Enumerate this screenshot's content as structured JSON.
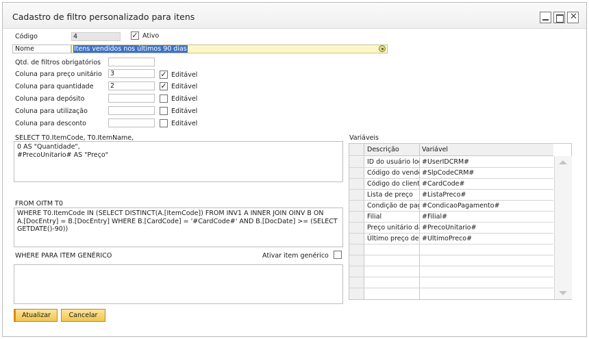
{
  "window": {
    "title": "Cadastro de filtro personalizado para itens"
  },
  "form": {
    "codigo_label": "Código",
    "codigo_value": "4",
    "ativo_label": "Ativo",
    "ativo_checked": true,
    "nome_label": "Nome",
    "nome_value": "Itens vendidos nos últimos 90 dias",
    "qtd_label": "Qtd. de filtros obrigatórios",
    "qtd_value": "",
    "editavel_label": "Editável",
    "columns": [
      {
        "label": "Coluna para preço unitário",
        "value": "3",
        "editavel": true
      },
      {
        "label": "Coluna para quantidade",
        "value": "2",
        "editavel": true
      },
      {
        "label": "Coluna para depósito",
        "value": "",
        "editavel": false
      },
      {
        "label": "Coluna para utilização",
        "value": "",
        "editavel": false
      },
      {
        "label": "Coluna para desconto",
        "value": "",
        "editavel": false
      }
    ]
  },
  "select": {
    "label": "SELECT T0.ItemCode, T0.ItemName,",
    "lines": [
      "0 AS \"Quantidade\",",
      "#PrecoUnitario# AS \"Preço\""
    ]
  },
  "from": {
    "label": "FROM OITM T0",
    "lines": [
      "WHERE T0.ItemCode IN (SELECT DISTINCT(A.[ItemCode]) FROM INV1 A  INNER JOIN OINV B ON",
      "A.[DocEntry] = B.[DocEntry] WHERE B.[CardCode] = '#CardCode#' AND  B.[DocDate] >= (SELECT",
      "GETDATE()-90))"
    ]
  },
  "where_generic": {
    "label": "WHERE PARA ITEM GENÉRICO",
    "ativar_label": "Ativar item genérico",
    "ativar_checked": false
  },
  "variables": {
    "label": "Variáveis",
    "col_descricao": "Descrição",
    "col_variavel": "Variável",
    "rows": [
      {
        "descricao": "ID do usuário logado",
        "variavel": "#UserIDCRM#"
      },
      {
        "descricao": "Código do vendedor",
        "variavel": "#SlpCodeCRM#"
      },
      {
        "descricao": "Código do cliente",
        "variavel": "#CardCode#"
      },
      {
        "descricao": "Lista de preço",
        "variavel": "#ListaPreco#"
      },
      {
        "descricao": "Condição de pagamento",
        "variavel": "#CondicaoPagamento#"
      },
      {
        "descricao": "Filial",
        "variavel": "#Filial#"
      },
      {
        "descricao": "Preço unitário da",
        "variavel": "#PrecoUnitario#"
      },
      {
        "descricao": "Último preço de venda",
        "variavel": "#UltimoPreco#"
      }
    ]
  },
  "buttons": {
    "update": "Atualizar",
    "cancel": "Cancelar"
  },
  "colors": {
    "button_fill": "#f2c44f",
    "selection": "#3e72c4",
    "name_field_bg": "#fdf7c4"
  }
}
